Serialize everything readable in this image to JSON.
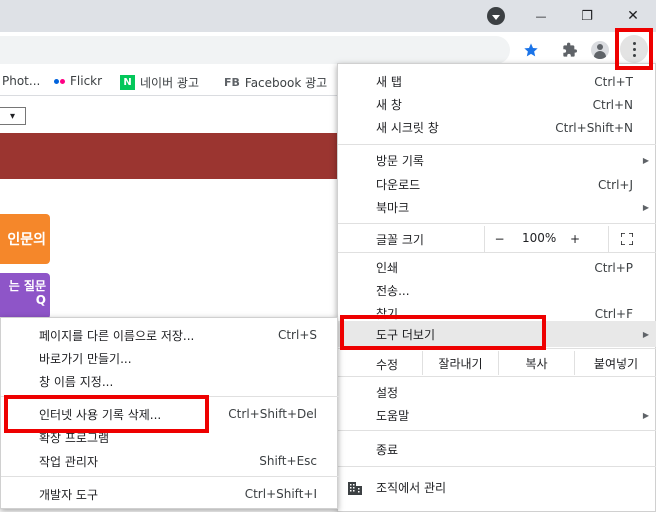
{
  "window_controls": {
    "minimize": "—",
    "maximize": "❐",
    "close": "✕"
  },
  "bookmarks": [
    {
      "label": "Phot...",
      "icon": "none"
    },
    {
      "label": "Flickr",
      "icon": "flickr-icon"
    },
    {
      "label": "네이버 광고",
      "icon": "naver-icon",
      "icon_text": "N"
    },
    {
      "label": "Facebook 광고",
      "icon": "facebook-icon",
      "icon_text": "FB"
    }
  ],
  "page": {
    "select_arrow": "▾",
    "orange_button": "인문의",
    "purple_button_line1": "는 질문",
    "purple_button_line2": "Q"
  },
  "menu": {
    "new_tab": {
      "label": "새 탭",
      "shortcut": "Ctrl+T"
    },
    "new_window": {
      "label": "새 창",
      "shortcut": "Ctrl+N"
    },
    "new_incognito": {
      "label": "새 시크릿 창",
      "shortcut": "Ctrl+Shift+N"
    },
    "history": {
      "label": "방문 기록"
    },
    "downloads": {
      "label": "다운로드",
      "shortcut": "Ctrl+J"
    },
    "bookmarks": {
      "label": "북마크"
    },
    "zoom": {
      "label": "글꼴 크기",
      "minus": "−",
      "value": "100%",
      "plus": "+"
    },
    "print": {
      "label": "인쇄",
      "shortcut": "Ctrl+P"
    },
    "cast": {
      "label": "전송..."
    },
    "find": {
      "label": "찾기",
      "shortcut": "Ctrl+F"
    },
    "more_tools": {
      "label": "도구 더보기"
    },
    "edit": {
      "label": "수정",
      "cut": "잘라내기",
      "copy": "복사",
      "paste": "붙여넣기"
    },
    "settings": {
      "label": "설정"
    },
    "help": {
      "label": "도움말"
    },
    "exit": {
      "label": "종료"
    },
    "managed": {
      "label": "조직에서 관리"
    }
  },
  "submenu": {
    "save_page": {
      "label": "페이지를 다른 이름으로 저장...",
      "shortcut": "Ctrl+S"
    },
    "create_shortcut": {
      "label": "바로가기 만들기..."
    },
    "name_window": {
      "label": "창 이름 지정..."
    },
    "clear_data": {
      "label": "인터넷 사용 기록 삭제...",
      "shortcut": "Ctrl+Shift+Del"
    },
    "extensions": {
      "label": "확장 프로그램"
    },
    "task_manager": {
      "label": "작업 관리자",
      "shortcut": "Shift+Esc"
    },
    "dev_tools": {
      "label": "개발자 도구",
      "shortcut": "Ctrl+Shift+I"
    }
  },
  "colors": {
    "highlight_box": "#ee0000",
    "star": "#1a73e8"
  }
}
